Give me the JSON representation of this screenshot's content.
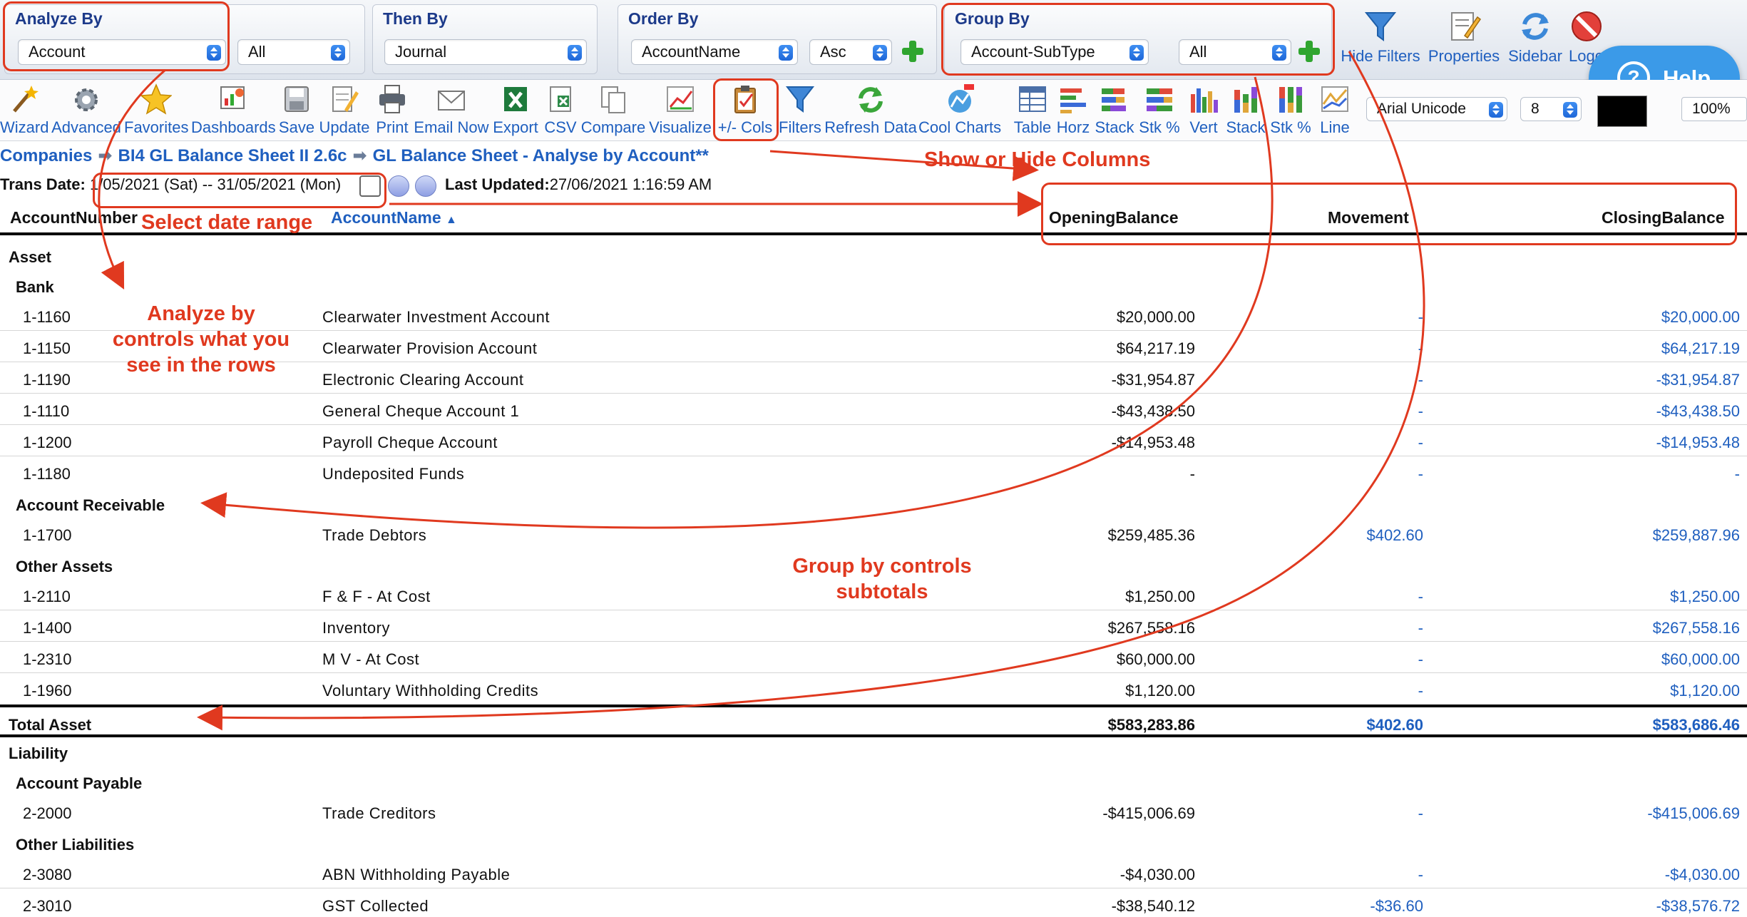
{
  "filters": {
    "analyze_by": {
      "title": "Analyze By",
      "value": "Account",
      "scope": "All"
    },
    "then_by": {
      "title": "Then By",
      "value": "Journal"
    },
    "order_by": {
      "title": "Order By",
      "value": "AccountName",
      "direction": "Asc"
    },
    "group_by": {
      "title": "Group By",
      "value": "Account-SubType",
      "scope": "All"
    }
  },
  "top_actions": [
    {
      "label": "Hide Filters",
      "icon": "funnel-icon"
    },
    {
      "label": "Properties",
      "icon": "properties-icon"
    },
    {
      "label": "Sidebar",
      "icon": "refresh-arrows-icon"
    },
    {
      "label": "Logout",
      "icon": "stop-icon"
    }
  ],
  "help_label": "Help",
  "toolbar": {
    "items": [
      {
        "label": "Wizard",
        "icon": "wand-icon"
      },
      {
        "label": "Advanced",
        "icon": "gear-icon"
      },
      {
        "label": "Favorites",
        "icon": "star-icon"
      },
      {
        "label": "Dashboards",
        "icon": "dashboard-icon"
      },
      {
        "label": "Save",
        "icon": "disk-icon"
      },
      {
        "label": "Update",
        "icon": "pencil-note-icon"
      },
      {
        "label": "Print",
        "icon": "printer-icon"
      },
      {
        "label": "Email Now",
        "icon": "envelope-icon"
      },
      {
        "label": "Export",
        "icon": "excel-icon"
      },
      {
        "label": "CSV",
        "icon": "csv-icon"
      },
      {
        "label": "Compare",
        "icon": "compare-pages-icon"
      },
      {
        "label": "Visualize",
        "icon": "line-chart-icon"
      },
      {
        "label": "+/- Cols",
        "icon": "clipboard-check-icon"
      },
      {
        "label": "Filters",
        "icon": "funnel-icon"
      },
      {
        "label": "Refresh Data",
        "icon": "refresh-icon"
      },
      {
        "label": "Cool Charts",
        "icon": "cool-charts-icon"
      },
      {
        "label": "Table",
        "icon": "table-icon"
      },
      {
        "label": "Horz",
        "icon": "horizontal-bars-icon"
      },
      {
        "label": "Stack",
        "icon": "stacked-horizontal-icon"
      },
      {
        "label": "Stk %",
        "icon": "stacked-percent-horizontal-icon"
      },
      {
        "label": "Vert",
        "icon": "vertical-bars-icon"
      },
      {
        "label": "Stack",
        "icon": "stacked-vertical-icon"
      },
      {
        "label": "Stk %",
        "icon": "stacked-percent-vertical-icon"
      },
      {
        "label": "Line",
        "icon": "line-icon"
      }
    ],
    "font": "Arial Unicode",
    "font_size": "8",
    "zoom": "100%"
  },
  "breadcrumb": [
    "Companies",
    "BI4 GL Balance Sheet II 2.6c",
    "GL Balance Sheet - Analyse by Account**"
  ],
  "date_bar": {
    "label": "Trans Date:",
    "range": "1/05/2021 (Sat) -- 31/05/2021 (Mon)",
    "updated_label": "Last Updated:",
    "updated_value": "27/06/2021 1:16:59 AM"
  },
  "columns": {
    "account_number": "AccountNumber",
    "account_name": "AccountName",
    "opening": "OpeningBalance",
    "movement": "Movement",
    "closing": "ClosingBalance"
  },
  "rows": [
    {
      "kind": "type",
      "label": "Asset"
    },
    {
      "kind": "group",
      "label": "Bank"
    },
    {
      "kind": "data",
      "num": "1-1160",
      "name": "Clearwater Investment Account",
      "opening": "$20,000.00",
      "movement": "-",
      "closing": "$20,000.00"
    },
    {
      "kind": "data",
      "num": "1-1150",
      "name": "Clearwater Provision Account",
      "opening": "$64,217.19",
      "movement": "-",
      "closing": "$64,217.19"
    },
    {
      "kind": "data",
      "num": "1-1190",
      "name": "Electronic Clearing Account",
      "opening": "-$31,954.87",
      "movement": "-",
      "closing": "-$31,954.87"
    },
    {
      "kind": "data",
      "num": "1-1110",
      "name": "General Cheque Account 1",
      "opening": "-$43,438.50",
      "movement": "-",
      "closing": "-$43,438.50"
    },
    {
      "kind": "data",
      "num": "1-1200",
      "name": "Payroll Cheque Account",
      "opening": "-$14,953.48",
      "movement": "-",
      "closing": "-$14,953.48"
    },
    {
      "kind": "data",
      "num": "1-1180",
      "name": "Undeposited Funds",
      "opening": "-",
      "movement": "-",
      "closing": "-"
    },
    {
      "kind": "group",
      "label": "Account Receivable"
    },
    {
      "kind": "data",
      "num": "1-1700",
      "name": "Trade Debtors",
      "opening": "$259,485.36",
      "movement": "$402.60",
      "closing": "$259,887.96"
    },
    {
      "kind": "group",
      "label": "Other Assets"
    },
    {
      "kind": "data",
      "num": "1-2110",
      "name": "F & F - At Cost",
      "opening": "$1,250.00",
      "movement": "-",
      "closing": "$1,250.00"
    },
    {
      "kind": "data",
      "num": "1-1400",
      "name": "Inventory",
      "opening": "$267,558.16",
      "movement": "-",
      "closing": "$267,558.16"
    },
    {
      "kind": "data",
      "num": "1-2310",
      "name": "M V - At Cost",
      "opening": "$60,000.00",
      "movement": "-",
      "closing": "$60,000.00"
    },
    {
      "kind": "data",
      "num": "1-1960",
      "name": "Voluntary Withholding Credits",
      "opening": "$1,120.00",
      "movement": "-",
      "closing": "$1,120.00"
    },
    {
      "kind": "total",
      "label": "Total Asset",
      "opening": "$583,283.86",
      "movement": "$402.60",
      "closing": "$583,686.46"
    },
    {
      "kind": "type",
      "label": "Liability"
    },
    {
      "kind": "group",
      "label": "Account Payable"
    },
    {
      "kind": "data",
      "num": "2-2000",
      "name": "Trade Creditors",
      "opening": "-$415,006.69",
      "movement": "-",
      "closing": "-$415,006.69"
    },
    {
      "kind": "group",
      "label": "Other Liabilities"
    },
    {
      "kind": "data",
      "num": "2-3080",
      "name": "ABN Withholding Payable",
      "opening": "-$4,030.00",
      "movement": "-",
      "closing": "-$4,030.00"
    },
    {
      "kind": "data",
      "num": "2-3010",
      "name": "GST Collected",
      "opening": "-$38,540.12",
      "movement": "-$36.60",
      "closing": "-$38,576.72"
    }
  ],
  "annotations": {
    "show_hide_columns": "Show or Hide Columns",
    "select_date_range": "Select date range",
    "analyze_by_note": [
      "Analyze by",
      "controls what you",
      "see in the rows"
    ],
    "group_by_note": [
      "Group by controls",
      "subtotals"
    ],
    "color": "#e0391f"
  }
}
